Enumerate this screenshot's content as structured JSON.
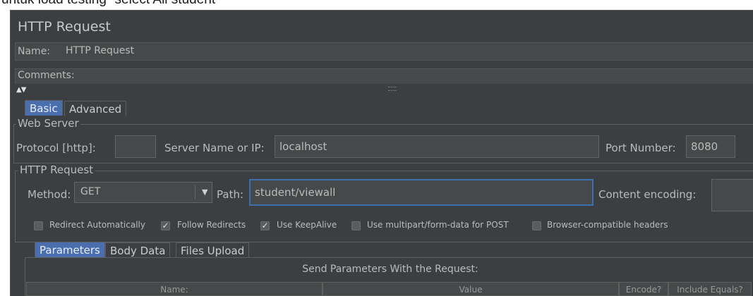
{
  "doc": {
    "caption": "untuk load testing “select All student”"
  },
  "panel": {
    "title": "HTTP Request",
    "name_label": "Name:",
    "name_value": "HTTP Request",
    "comments_label": "Comments:"
  },
  "tabs": [
    {
      "label": "Basic",
      "selected": true
    },
    {
      "label": "Advanced",
      "selected": false
    }
  ],
  "web_server": {
    "group_title": "Web Server",
    "protocol_label": "Protocol [http]:",
    "protocol_value": "",
    "server_label": "Server Name or IP:",
    "server_value": "localhost",
    "port_label": "Port Number:",
    "port_value": "8080"
  },
  "http_request": {
    "group_title": "HTTP Request",
    "method_label": "Method:",
    "method_value": "GET",
    "path_label": "Path:",
    "path_value": "student/viewall",
    "encoding_label": "Content encoding:",
    "encoding_value": ""
  },
  "options": [
    {
      "label": "Redirect Automatically",
      "checked": false
    },
    {
      "label": "Follow Redirects",
      "checked": true
    },
    {
      "label": "Use KeepAlive",
      "checked": true
    },
    {
      "label": "Use multipart/form-data for POST",
      "checked": false
    },
    {
      "label": "Browser-compatible headers",
      "checked": false
    }
  ],
  "sub_tabs": [
    {
      "label": "Parameters",
      "selected": true
    },
    {
      "label": "Body Data",
      "selected": false
    },
    {
      "label": "Files Upload",
      "selected": false
    }
  ],
  "params_table": {
    "title": "Send Parameters With the Request:",
    "columns": [
      "Name:",
      "Value",
      "Encode?",
      "Include Equals?"
    ]
  },
  "colors": {
    "background": "#3c3f41",
    "field": "#45494a",
    "selected_tab": "#4b6eaf",
    "focus_border": "#3d6fae"
  }
}
